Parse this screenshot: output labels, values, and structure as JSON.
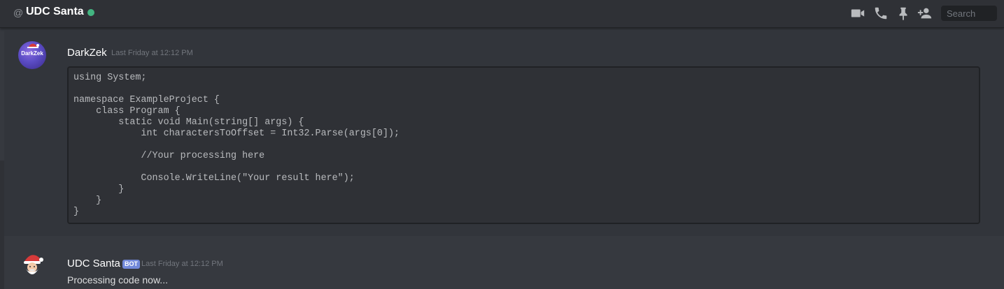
{
  "header": {
    "at_symbol": "@",
    "title": "UDC Santa",
    "status": "online",
    "status_color": "#43b581",
    "icons": [
      "video-icon",
      "phone-icon",
      "pin-icon",
      "add-friend-icon"
    ],
    "search_placeholder": "Search"
  },
  "messages": [
    {
      "author": "DarkZek",
      "avatar_text": "DarkZek",
      "timestamp": "Last Friday at 12:12 PM",
      "code_lines": [
        "using System;",
        "",
        "namespace ExampleProject {",
        "    class Program {",
        "        static void Main(string[] args) {",
        "            int charactersToOffset = Int32.Parse(args[0]);",
        "",
        "            //Your processing here",
        "",
        "            Console.WriteLine(\"Your result here\");",
        "        }",
        "    }",
        "}"
      ]
    },
    {
      "author": "UDC Santa",
      "bot_tag": "BOT",
      "timestamp": "Last Friday at 12:12 PM",
      "text": "Processing code now..."
    }
  ]
}
